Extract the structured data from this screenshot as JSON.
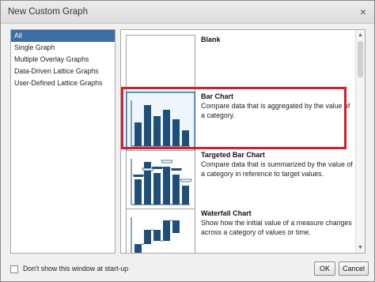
{
  "dialog": {
    "title": "New Custom Graph",
    "close_glyph": "×"
  },
  "categories": [
    {
      "label": "All",
      "selected": true
    },
    {
      "label": "Single Graph",
      "selected": false
    },
    {
      "label": "Multiple Overlay Graphs",
      "selected": false
    },
    {
      "label": "Data-Driven Lattice Graphs",
      "selected": false
    },
    {
      "label": "User-Defined Lattice Graphs",
      "selected": false
    }
  ],
  "graphs": [
    {
      "name": "Blank",
      "description": ""
    },
    {
      "name": "Bar Chart",
      "description": "Compare data that is aggregated by the value of a category.",
      "selected": true
    },
    {
      "name": "Targeted Bar Chart",
      "description": "Compare data that is summarized by the value of a category in reference to target values."
    },
    {
      "name": "Waterfall Chart",
      "description": "Show how the initial value of a measure changes across a category of values or time."
    }
  ],
  "footer": {
    "checkbox_label": "Don't show this window at start-up",
    "checkbox_checked": false,
    "ok_label": "OK",
    "cancel_label": "Cancel"
  },
  "colors": {
    "selection": "#3a6ea5",
    "bar": "#1f4e79",
    "highlight": "#d81d2a"
  }
}
